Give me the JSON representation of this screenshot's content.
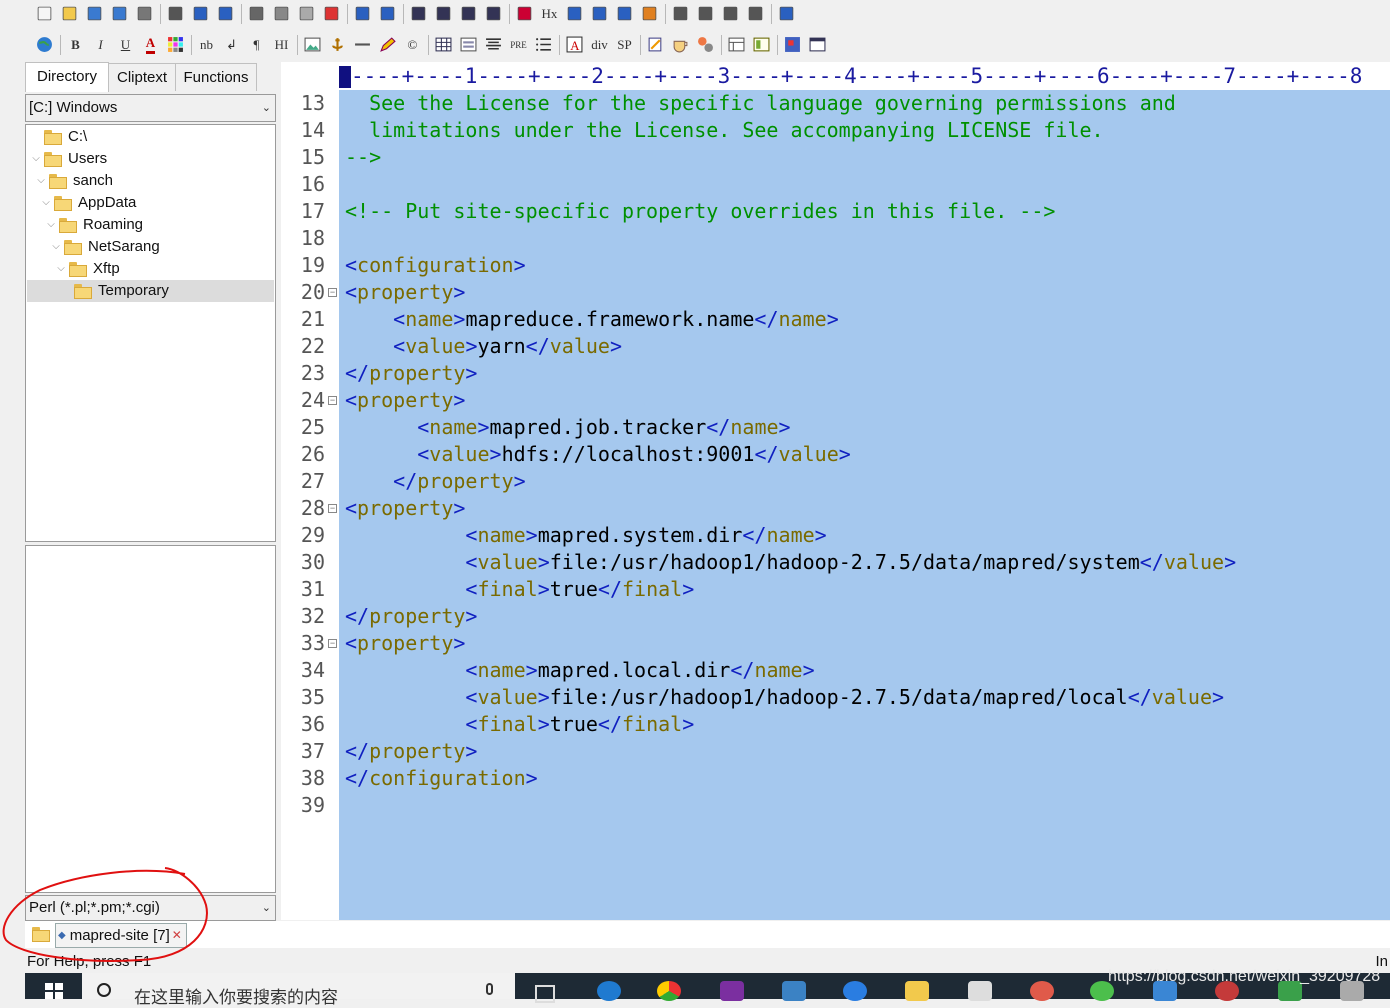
{
  "window": {
    "toolbar_top": {
      "icons": [
        "new-file-icon",
        "open-folder-icon",
        "save-icon",
        "save-all-icon",
        "print-preview-icon",
        "print-icon",
        "spell-check-icon",
        "insert-file-icon",
        "cut-icon",
        "copy-icon",
        "paste-icon",
        "delete-icon",
        "undo-icon",
        "redo-icon",
        "find-icon",
        "replace-icon",
        "find-in-files-icon",
        "goto-icon",
        "font-size-icon",
        "heading-icon",
        "word-wrap-icon",
        "reformat-icon",
        "compare-icon",
        "check-icon",
        "view-1-icon",
        "view-2-icon",
        "view-3-icon",
        "view-4-icon",
        "help-icon"
      ],
      "labels": {
        "hx": "Hx"
      }
    },
    "toolbar_bottom": {
      "labels": {
        "bold": "B",
        "italic": "I",
        "underline": "U",
        "font_color": "A",
        "nbsp": "nb",
        "paragraph": "¶",
        "hr": "HI",
        "pre": "PRE",
        "div": "div",
        "span": "SP"
      }
    }
  },
  "left_pane": {
    "tabs": [
      "Directory",
      "Cliptext",
      "Functions"
    ],
    "active_tab": "Directory",
    "drive_select": "[C:] Windows",
    "tree": [
      {
        "label": "C:\\",
        "depth": 0,
        "expander": ""
      },
      {
        "label": "Users",
        "depth": 0,
        "expander": "v"
      },
      {
        "label": "sanch",
        "depth": 1,
        "expander": "v"
      },
      {
        "label": "AppData",
        "depth": 2,
        "expander": "v"
      },
      {
        "label": "Roaming",
        "depth": 3,
        "expander": "v"
      },
      {
        "label": "NetSarang",
        "depth": 4,
        "expander": "v"
      },
      {
        "label": "Xftp",
        "depth": 5,
        "expander": "v"
      },
      {
        "label": "Temporary",
        "depth": 6,
        "expander": ""
      }
    ],
    "selected_item": "Temporary",
    "filter_select": "Perl (*.pl;*.pm;*.cgi)"
  },
  "editor": {
    "ruler": "----+----1----+----2----+----3----+----4----+----5----+----6----+----7----+----8",
    "lines": [
      {
        "n": "13",
        "fold": false,
        "code": "  See the License for the specific language governing permissions and"
      },
      {
        "n": "14",
        "fold": false,
        "code": "  limitations under the License. See accompanying LICENSE file."
      },
      {
        "n": "15",
        "fold": false,
        "code": "-->"
      },
      {
        "n": "16",
        "fold": false,
        "code": ""
      },
      {
        "n": "17",
        "fold": false,
        "code": "<!-- Put site-specific property overrides in this file. -->"
      },
      {
        "n": "18",
        "fold": false,
        "code": ""
      },
      {
        "n": "19",
        "fold": false,
        "code": "<configuration>"
      },
      {
        "n": "20",
        "fold": true,
        "code": "<property>"
      },
      {
        "n": "21",
        "fold": false,
        "code": "    <name>mapreduce.framework.name</name>"
      },
      {
        "n": "22",
        "fold": false,
        "code": "    <value>yarn</value>"
      },
      {
        "n": "23",
        "fold": false,
        "code": "</property>"
      },
      {
        "n": "24",
        "fold": true,
        "code": "<property>"
      },
      {
        "n": "25",
        "fold": false,
        "code": "      <name>mapred.job.tracker</name>"
      },
      {
        "n": "26",
        "fold": false,
        "code": "      <value>hdfs://localhost:9001</value>"
      },
      {
        "n": "27",
        "fold": false,
        "code": "    </property>"
      },
      {
        "n": "28",
        "fold": true,
        "code": "<property>"
      },
      {
        "n": "29",
        "fold": false,
        "code": "          <name>mapred.system.dir</name>"
      },
      {
        "n": "30",
        "fold": false,
        "code": "          <value>file:/usr/hadoop1/hadoop-2.7.5/data/mapred/system</value>"
      },
      {
        "n": "31",
        "fold": false,
        "code": "          <final>true</final>"
      },
      {
        "n": "32",
        "fold": false,
        "code": "</property>"
      },
      {
        "n": "33",
        "fold": true,
        "code": "<property>"
      },
      {
        "n": "34",
        "fold": false,
        "code": "          <name>mapred.local.dir</name>"
      },
      {
        "n": "35",
        "fold": false,
        "code": "          <value>file:/usr/hadoop1/hadoop-2.7.5/data/mapred/local</value>"
      },
      {
        "n": "36",
        "fold": false,
        "code": "          <final>true</final>"
      },
      {
        "n": "37",
        "fold": false,
        "code": "</property>"
      },
      {
        "n": "38",
        "fold": false,
        "code": "</configuration>"
      },
      {
        "n": "39",
        "fold": false,
        "code": ""
      }
    ],
    "colors": {
      "tag": "#1020c0",
      "tag_name": "#7a6a00",
      "comment": "#009000",
      "selection": "#a5c8ee"
    }
  },
  "document_tabs": [
    {
      "label": "mapred-site [7]",
      "close": "✕"
    }
  ],
  "status_bar": {
    "help": "For Help, press F1",
    "right": "In"
  },
  "taskbar": {
    "search_placeholder": "在这里输入你要搜索的内容",
    "watermark": "https://blog.csdn.net/weixin_39209728",
    "icons": [
      "task-view-icon",
      "edge-icon",
      "chrome-icon",
      "onenote-icon",
      "store-icon",
      "app-blue-icon",
      "file-explorer-icon",
      "mail-icon",
      "pinwheel-icon",
      "wechat-icon",
      "network-icon",
      "app-red-icon",
      "app-green-icon",
      "app-gray-icon"
    ]
  }
}
